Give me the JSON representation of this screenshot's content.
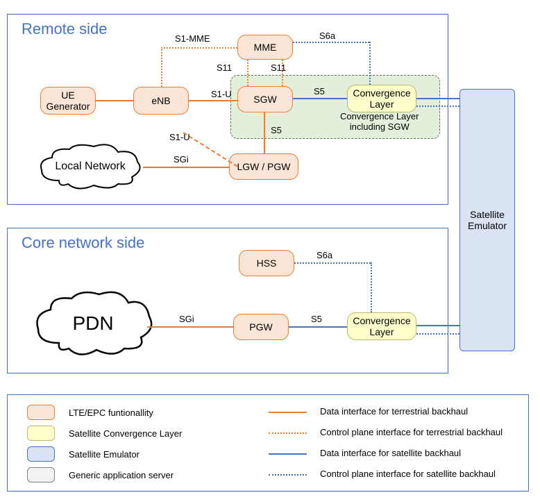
{
  "panels": {
    "remote": "Remote side",
    "core": "Core network side"
  },
  "nodes": {
    "ue_gen": "UE\nGenerator",
    "enb": "eNB",
    "mme": "MME",
    "sgw": "SGW",
    "conv1": "Convergence\nLayer",
    "lgw_pgw": "LGW / PGW",
    "local_net": "Local Network",
    "hss": "HSS",
    "pgw": "PGW",
    "conv2": "Convergence\nLayer",
    "pdn": "PDN",
    "sat": "Satellite\nEmulator"
  },
  "sgw_box_caption": "Convergence Layer\nincluding SGW",
  "interfaces": {
    "s1_mme": "S1-MME",
    "s11_left": "S11",
    "s11_right": "S11",
    "s1_u": "S1-U",
    "s1_u2": "S1-U",
    "s5_top": "S5",
    "s5_mid": "S5",
    "sgi": "SGi",
    "s6a_top": "S6a",
    "s6a_bot": "S6a",
    "sgi_bot": "SGi",
    "s5_bot": "S5"
  },
  "legend": {
    "lte": "LTE/EPC funtionallity",
    "scl": "Satellite Convergence Layer",
    "sat": "Satellite Emulator",
    "gen": "Generic application server",
    "data_terr": "Data interface for terrestrial backhaul",
    "ctrl_terr": "Control plane interface for terrestrial backhaul",
    "data_sat": "Data interface for satellite backhaul",
    "ctrl_sat": "Control plane interface for satellite backhaul"
  }
}
